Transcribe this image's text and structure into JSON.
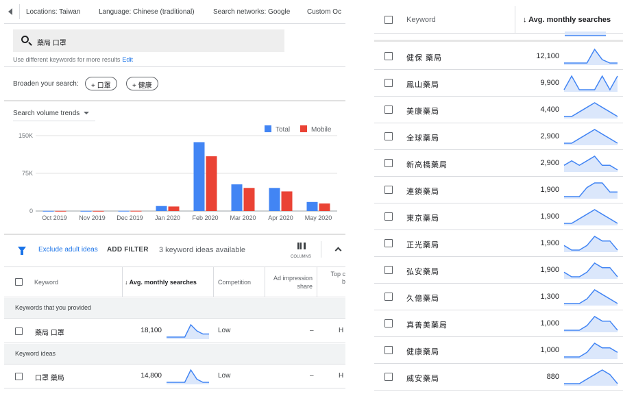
{
  "filters": {
    "location": "Locations: Taiwan",
    "language": "Language: Chinese (traditional)",
    "network": "Search networks: Google",
    "custom": "Custom Oc"
  },
  "search": {
    "query": "藥局 口罩",
    "hint": "Use different keywords for more results",
    "edit_label": "Edit"
  },
  "broaden": {
    "label": "Broaden your search:",
    "chips": [
      "+ 口罩",
      "+ 健康"
    ]
  },
  "trend": {
    "title": "Search volume trends",
    "legend_total": "Total",
    "legend_mobile": "Mobile",
    "colors": {
      "total": "#4285f4",
      "mobile": "#ea4335"
    }
  },
  "chart_data": {
    "type": "bar",
    "title": "Search volume trends",
    "categories": [
      "Oct 2019",
      "Nov 2019",
      "Dec 2019",
      "Jan 2020",
      "Feb 2020",
      "Mar 2020",
      "Apr 2020",
      "May 2020"
    ],
    "series": [
      {
        "name": "Total",
        "values": [
          300,
          300,
          400,
          10000,
          137000,
          53000,
          46000,
          18000
        ]
      },
      {
        "name": "Mobile",
        "values": [
          300,
          300,
          400,
          9000,
          109000,
          46000,
          39000,
          15000
        ]
      }
    ],
    "yticks": [
      "0",
      "75K",
      "150K"
    ],
    "ylim": [
      0,
      150000
    ],
    "grid": true,
    "legend": "top-right"
  },
  "toolbar": {
    "exclude_label": "Exclude adult ideas",
    "add_filter_label": "ADD FILTER",
    "count_label": "3 keyword ideas available",
    "columns_label": "COLUMNS"
  },
  "table": {
    "col_keyword": "Keyword",
    "col_searches": "↓ Avg. monthly searches",
    "col_competition": "Competition",
    "col_impression": "Ad impression share",
    "col_top": "Top c b",
    "group_provided": "Keywords that you provided",
    "group_ideas": "Keyword ideas",
    "provided_rows": [
      {
        "keyword": "藥局 口罩",
        "volume": "18,100",
        "competition": "Low",
        "impression": "–",
        "top": "H"
      }
    ],
    "idea_rows": [
      {
        "keyword": "口罩 藥局",
        "volume": "14,800",
        "competition": "Low",
        "impression": "–",
        "top": "H"
      }
    ]
  },
  "right_table": {
    "col_keyword": "Keyword",
    "col_searches": "↓ Avg. monthly searches",
    "rows": [
      {
        "keyword": "健保 藥局",
        "volume": "12,100",
        "trend": [
          1,
          1,
          1,
          1,
          5,
          2,
          1,
          1
        ]
      },
      {
        "keyword": "鳳山藥局",
        "volume": "9,900",
        "trend": [
          1,
          5,
          1,
          1,
          1,
          5,
          1,
          5
        ]
      },
      {
        "keyword": "美康藥局",
        "volume": "4,400",
        "trend": [
          1,
          1,
          2,
          3,
          4,
          3,
          2,
          1
        ]
      },
      {
        "keyword": "全球藥局",
        "volume": "2,900",
        "trend": [
          1,
          1,
          2,
          3,
          4,
          3,
          2,
          1
        ]
      },
      {
        "keyword": "新高橋藥局",
        "volume": "2,900",
        "trend": [
          2,
          3,
          2,
          3,
          4,
          2,
          2,
          1
        ]
      },
      {
        "keyword": "連鎖藥局",
        "volume": "1,900",
        "trend": [
          1,
          1,
          1,
          3,
          4,
          4,
          2,
          2
        ]
      },
      {
        "keyword": "東京藥局",
        "volume": "1,900",
        "trend": [
          1,
          1,
          2,
          3,
          4,
          3,
          2,
          1
        ]
      },
      {
        "keyword": "正光藥局",
        "volume": "1,900",
        "trend": [
          2,
          1,
          1,
          2,
          4,
          3,
          3,
          1
        ]
      },
      {
        "keyword": "弘安藥局",
        "volume": "1,900",
        "trend": [
          2,
          1,
          1,
          2,
          4,
          3,
          3,
          1
        ]
      },
      {
        "keyword": "久億藥局",
        "volume": "1,300",
        "trend": [
          1,
          1,
          1,
          2,
          4,
          3,
          2,
          1
        ]
      },
      {
        "keyword": "真善美藥局",
        "volume": "1,000",
        "trend": [
          1,
          1,
          1,
          2,
          4,
          3,
          3,
          1
        ]
      },
      {
        "keyword": "健康藥局",
        "volume": "1,000",
        "trend": [
          1,
          1,
          1,
          2,
          4,
          3,
          3,
          2
        ]
      },
      {
        "keyword": "威安藥局",
        "volume": "880",
        "trend": [
          1,
          1,
          1,
          2,
          3,
          4,
          3,
          1
        ]
      }
    ]
  },
  "left_trends": {
    "provided": [
      1,
      1,
      1,
      1,
      5,
      3,
      2,
      2
    ],
    "ideas": [
      1,
      1,
      1,
      1,
      5,
      2,
      1,
      1
    ]
  }
}
